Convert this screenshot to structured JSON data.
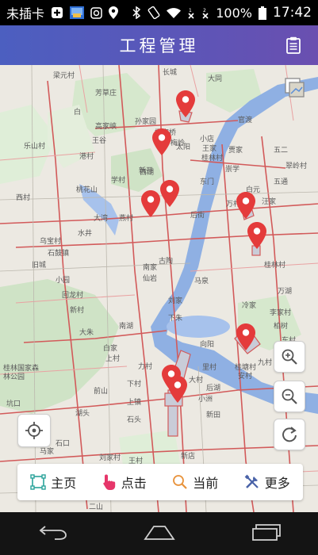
{
  "status_bar": {
    "carrier": "未插卡",
    "battery": "100%",
    "time": "17:42",
    "icons": [
      "plus-icon",
      "image-icon",
      "record-icon",
      "location-icon",
      "bluetooth-icon",
      "rotate-icon",
      "wifi-icon",
      "sim1-icon",
      "sim2-icon",
      "battery-icon"
    ]
  },
  "header": {
    "title": "工程管理",
    "action_icon": "clipboard-icon"
  },
  "map": {
    "place_labels": [
      "梁元村",
      "长城",
      "大同",
      "芳草庄",
      "白",
      "孙家园",
      "高家峡",
      "杨家桥",
      "乐山村",
      "王谷",
      "小店",
      "官渡",
      "梅岭",
      "王家",
      "贾家",
      "港村",
      "新开",
      "崇学",
      "学村",
      "东门",
      "翠岭村",
      "太阳",
      "桂林村",
      "桃花山",
      "白元",
      "西湖",
      "五二",
      "五通",
      "西村",
      "大湾",
      "燕村",
      "万村",
      "汪家",
      "水井",
      "后街",
      "乌宝村",
      "桂林村",
      "石鼓镇",
      "古陶",
      "南家",
      "旧城",
      "小园",
      "仙岩",
      "马泉",
      "回龙村",
      "冷家",
      "刘家",
      "万湖",
      "新村",
      "李家村",
      "南湖",
      "下朱",
      "柏树",
      "大朱",
      "东村",
      "向阳",
      "上村",
      "里村",
      "白家",
      "九村",
      "桂林国家森林公园",
      "力村",
      "下村",
      "坑口",
      "上镇",
      "前山",
      "后湖",
      "安村",
      "小洲",
      "新田",
      "湖头",
      "大村",
      "桂塘村",
      "石头",
      "石口",
      "刘家村",
      "新店",
      "王村",
      "二山",
      "马家"
    ],
    "controls": {
      "zoom_in": "zoom-in-icon",
      "zoom_out": "zoom-out-icon",
      "refresh": "refresh-icon",
      "locate": "locate-icon",
      "layers": "layers-icon"
    },
    "colors": {
      "water": "#8fb0e3",
      "park": "#cfe3c6",
      "road": "#d25a5a",
      "marker": "#e43b3b",
      "project_area": "#c9ccd8"
    }
  },
  "toolbar": {
    "items": [
      {
        "label": "主页",
        "icon": "home-frame-icon"
      },
      {
        "label": "点击",
        "icon": "hand-pointer-icon"
      },
      {
        "label": "当前",
        "icon": "search-icon"
      },
      {
        "label": "更多",
        "icon": "tools-icon"
      }
    ]
  },
  "nav_bar": {
    "buttons": [
      "back-icon",
      "home-icon",
      "recent-apps-icon"
    ]
  }
}
